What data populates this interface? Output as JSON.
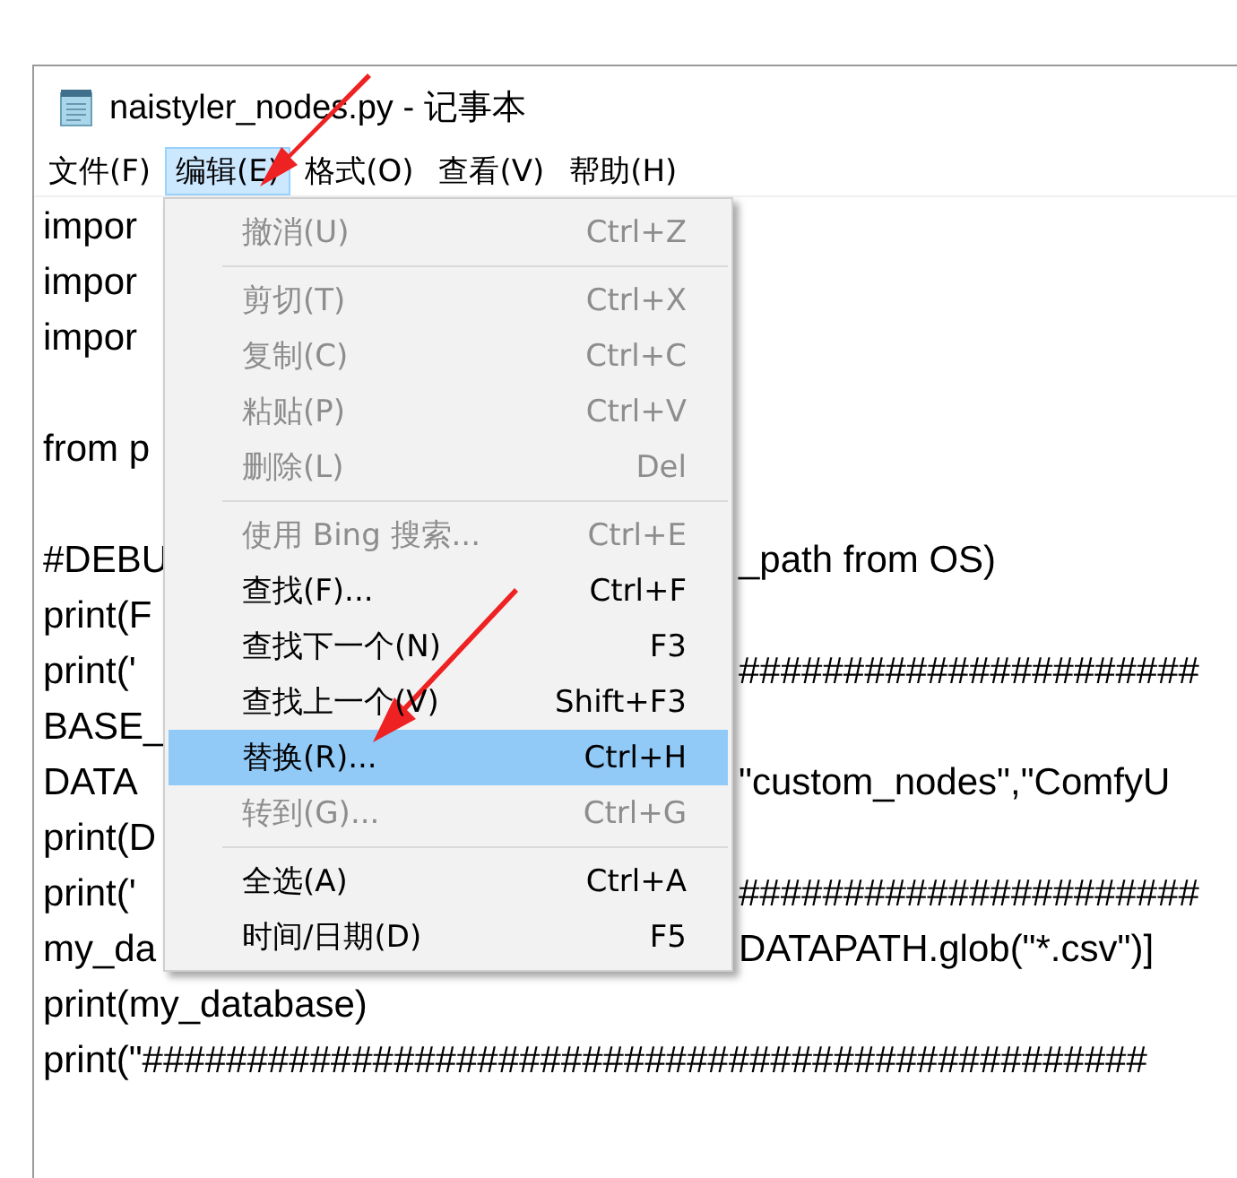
{
  "window": {
    "title": "naistyler_nodes.py - 记事本"
  },
  "menu_bar": [
    {
      "label": "文件(F)",
      "selected": false
    },
    {
      "label": "编辑(E)",
      "selected": true
    },
    {
      "label": "格式(O)",
      "selected": false
    },
    {
      "label": "查看(V)",
      "selected": false
    },
    {
      "label": "帮助(H)",
      "selected": false
    }
  ],
  "editor_lines": [
    {
      "kind": "code",
      "left": "impor"
    },
    {
      "kind": "code",
      "left": "impor"
    },
    {
      "kind": "code",
      "left": "impor"
    },
    {
      "kind": "blank"
    },
    {
      "kind": "code",
      "left": "from p"
    },
    {
      "kind": "blank"
    },
    {
      "kind": "code",
      "left": "#DEBU",
      "right": "_path from OS)"
    },
    {
      "kind": "code",
      "left": "print(F"
    },
    {
      "kind": "code",
      "left": "print('",
      "right": "######################"
    },
    {
      "kind": "code",
      "left": "BASE_"
    },
    {
      "kind": "code",
      "left": "DATA",
      "right": "\"custom_nodes\",\"ComfyU"
    },
    {
      "kind": "code",
      "left": "print(D"
    },
    {
      "kind": "code",
      "left": "print('",
      "right": "######################"
    },
    {
      "kind": "code",
      "left": "my_da",
      "right": "DATAPATH.glob(\"*.csv\")]"
    },
    {
      "kind": "code",
      "left": "print(my_database)"
    },
    {
      "kind": "code",
      "left": "print(\"################################################"
    }
  ],
  "edit_menu": [
    {
      "kind": "item",
      "label": "撤消(U)",
      "shortcut": "Ctrl+Z",
      "disabled": true,
      "selected": false
    },
    {
      "kind": "separator"
    },
    {
      "kind": "item",
      "label": "剪切(T)",
      "shortcut": "Ctrl+X",
      "disabled": true,
      "selected": false
    },
    {
      "kind": "item",
      "label": "复制(C)",
      "shortcut": "Ctrl+C",
      "disabled": true,
      "selected": false
    },
    {
      "kind": "item",
      "label": "粘贴(P)",
      "shortcut": "Ctrl+V",
      "disabled": true,
      "selected": false
    },
    {
      "kind": "item",
      "label": "删除(L)",
      "shortcut": "Del",
      "disabled": true,
      "selected": false
    },
    {
      "kind": "separator"
    },
    {
      "kind": "item",
      "label": "使用 Bing 搜索...",
      "shortcut": "Ctrl+E",
      "disabled": true,
      "selected": false
    },
    {
      "kind": "item",
      "label": "查找(F)...",
      "shortcut": "Ctrl+F",
      "disabled": false,
      "selected": false
    },
    {
      "kind": "item",
      "label": "查找下一个(N)",
      "shortcut": "F3",
      "disabled": false,
      "selected": false
    },
    {
      "kind": "item",
      "label": "查找上一个(V)",
      "shortcut": "Shift+F3",
      "disabled": false,
      "selected": false
    },
    {
      "kind": "item",
      "label": "替换(R)...",
      "shortcut": "Ctrl+H",
      "disabled": false,
      "selected": true
    },
    {
      "kind": "item",
      "label": "转到(G)...",
      "shortcut": "Ctrl+G",
      "disabled": true,
      "selected": false
    },
    {
      "kind": "separator"
    },
    {
      "kind": "item",
      "label": "全选(A)",
      "shortcut": "Ctrl+A",
      "disabled": false,
      "selected": false
    },
    {
      "kind": "item",
      "label": "时间/日期(D)",
      "shortcut": "F5",
      "disabled": false,
      "selected": false
    }
  ]
}
